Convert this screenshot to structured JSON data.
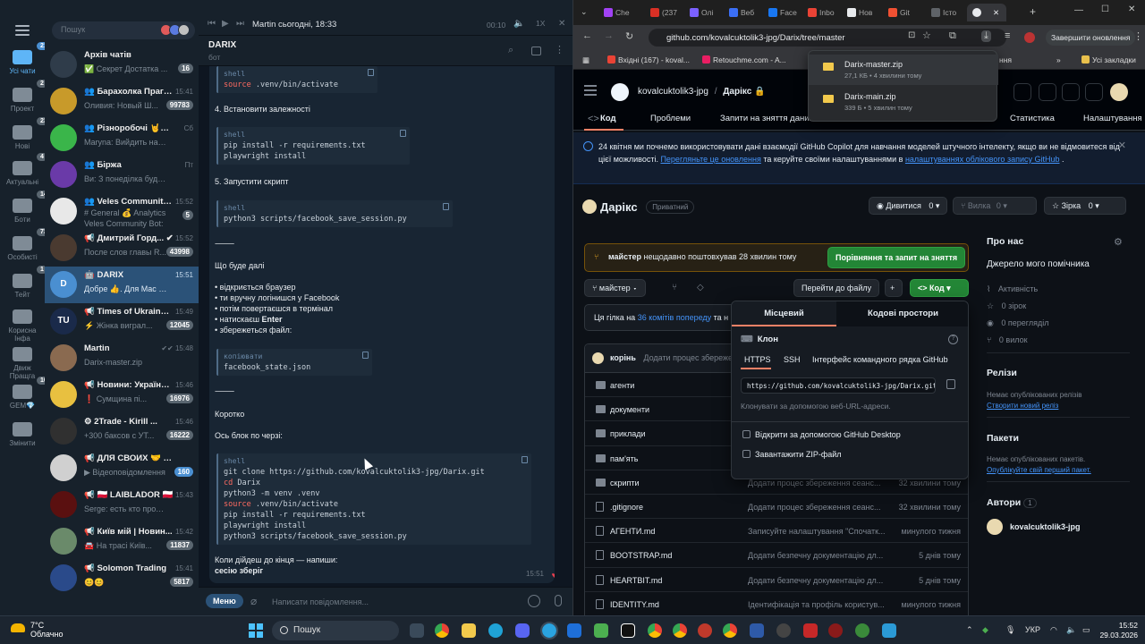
{
  "telegram": {
    "search_placeholder": "Пошук",
    "folders": [
      {
        "label": "Усі чати",
        "badge": "214",
        "active": true
      },
      {
        "label": "Проект",
        "badge": "2"
      },
      {
        "label": "Нові",
        "badge": "230"
      },
      {
        "label": "Актуальні",
        "badge": "4"
      },
      {
        "label": "Боти",
        "badge": "14"
      },
      {
        "label": "Особисті",
        "badge": "73"
      },
      {
        "label": "Тейт",
        "badge": "1"
      },
      {
        "label": "Корисна Інфа",
        "badge": ""
      },
      {
        "label": "Движ Пращга",
        "badge": ""
      },
      {
        "label": "GEM💎",
        "badge": "10"
      },
      {
        "label": "Змінити",
        "badge": ""
      }
    ],
    "chats": [
      {
        "name": "Архів чатів",
        "preview": "✅ Секрет Достатка ...",
        "time": "",
        "badge": "16",
        "color": "#2f3c4a"
      },
      {
        "name": "👥 Барахолка Прага...",
        "preview": "Оливия: Новый Ш...",
        "time": "15:41",
        "badge": "99783",
        "color": "#c89a2a"
      },
      {
        "name": "👥 Різноробочі 🤘😎...",
        "preview": "Maryna: Вийдить на двір",
        "time": "Сб",
        "badge": "",
        "color": "#3ab54a"
      },
      {
        "name": "👥 Біржа",
        "preview": "Ви: З понеділка буду то...",
        "time": "Пт",
        "badge": "",
        "color": "#6a3aa8"
      },
      {
        "name": "👥 Veles Community ...",
        "preview": "# General  💰 Analytics",
        "preview2": "Veles Community Bot:",
        "time": "15:52",
        "badge": "5",
        "color": "#e8e8e8"
      },
      {
        "name": "📢 Дмитрий Горд... ✔",
        "preview": "После слов главы R...",
        "time": "15:52",
        "badge": "43998",
        "color": "#4a3a30"
      },
      {
        "name": "🤖 DARIX",
        "preview": "Добре 👍. Для Mac команд...",
        "time": "15:51",
        "badge": "",
        "color": "#4a8fd1",
        "selected": true,
        "initial": "D"
      },
      {
        "name": "📢 Times of Ukraine:...",
        "preview": "⚡ Жінка виграл...",
        "time": "15:49",
        "badge": "12045",
        "color": "#1a2a4a",
        "initial": "TU"
      },
      {
        "name": "Martin",
        "preview": "Darix-master.zip",
        "time": "✔✔ 15:48",
        "badge": "",
        "color": "#8a6a50"
      },
      {
        "name": "📢 Новини: Україна ...",
        "preview": "❗ Сумщина пі...",
        "time": "15:46",
        "badge": "16976",
        "color": "#e8c040"
      },
      {
        "name": "⚙ 2Trade - Kirill ...",
        "preview": "+300 баксов с УТ...",
        "time": "15:46",
        "badge": "16222",
        "color": "#303030"
      },
      {
        "name": "📢 ДЛЯ СВОИХ 🤝 Д...",
        "preview": "▶ Відеоповідомлення",
        "time": "",
        "badge": "160",
        "color": "#d0d0d0",
        "blue": true
      },
      {
        "name": "📢 🇵🇱 LAIBLADOR 🇵🇱",
        "preview": "Serge: есть кто продает...",
        "time": "15:43",
        "badge": "",
        "color": "#5a1010"
      },
      {
        "name": "📢 Київ мій | Новин...",
        "preview": "🚘 На трасі Київ...",
        "time": "15:42",
        "badge": "11837",
        "color": "#6a8a6a"
      },
      {
        "name": "📢 Solomon Trading",
        "preview": "😊😊",
        "time": "15:41",
        "badge": "5817",
        "color": "#2a4a8a"
      }
    ],
    "media": {
      "title": "Martin сьогодні, 18:33",
      "time": "00:10",
      "speed": "1X"
    },
    "conversation": {
      "name": "DARIX",
      "subtitle": "бот"
    },
    "message": {
      "code0_lang": "shell",
      "code0_kw": "source",
      "code0_rest": " .venv/bin/activate",
      "step4": "4. Встановити залежності",
      "code1_lang": "shell",
      "code1_l1": "pip install -r requirements.txt",
      "code1_l2": "playwright install",
      "step5": "5. Запустити скрипт",
      "code2_lang": "shell",
      "code2_l1": "python3 scripts/facebook_save_session.py",
      "dash1": "⸻",
      "what": "Що буде далі",
      "b1": "• відкриється браузер",
      "b2": "• ти вручну логінишся у Facebook",
      "b3": "• потім повертаєшся в термінал",
      "b4a": "• натискаєш ",
      "b4b": "Enter",
      "b5": "• збережеться файл:",
      "code3_lang": "копіювати",
      "code3_l1": "facebook_state.json",
      "dash2": "⸻",
      "short": "Коротко",
      "block": "Ось блок по черзі:",
      "code4_lang": "shell",
      "code4_l1": "git clone https://github.com/kovalcuktolik3-jpg/Darix.git",
      "code4_kw_cd": "cd",
      "code4_l2": " Darix",
      "code4_l3": "python3 -m venv .venv",
      "code4_kw_src": "source",
      "code4_l4": " .venv/bin/activate",
      "code4_l5": "pip install -r requirements.txt",
      "code4_l6": "playwright install",
      "code4_l7": "python3 scripts/facebook_save_session.py",
      "end1": "Коли дійдеш до кінця — напиши:",
      "end2": "сесію зберіг",
      "time": "15:51"
    },
    "input": {
      "menu": "Меню",
      "placeholder": "Написати повідомлення..."
    }
  },
  "chrome": {
    "tabs": [
      "Che",
      "(237",
      "Олі",
      "Веб",
      "Face",
      "Inbo",
      "Нов",
      "Git",
      "Істо",
      ""
    ],
    "url": "github.com/kovalcuktolik3-jpg/Darix/tree/master",
    "end_session": "Завершити оновлення",
    "bookmarks": [
      "Вхідні (167) - koval...",
      "Retouchme.com - A..."
    ],
    "bookmarks_right": "Усі закладки",
    "bookmark_partial": "ння",
    "downloads": [
      {
        "name": "Darix-master.zip",
        "meta": "27,1 КБ • 4 хвилини тому"
      },
      {
        "name": "Darix-main.zip",
        "meta": "339 Б • 5 хвилин тому"
      }
    ]
  },
  "github": {
    "owner": "kovalcuktolik3-jpg",
    "repo": "Дарікс 🔒",
    "nav": [
      "Код",
      "Проблеми",
      "Запити на зняття даних",
      "Статистика",
      "Налаштування"
    ],
    "banner_text1": "24 квітня ми почнемо використовувати дані взаємодії GitHub Copilot для навчання моделей штучного інтелекту, якщо ви не відмовитеся від цієї можливості. ",
    "banner_link1": "Перегляньте це оновлення",
    "banner_text2": " та керуйте своїми налаштуваннями в ",
    "banner_link2": "налаштуваннях облікового запису GitHub",
    "banner_text3": " .",
    "title": "Дарікс",
    "visibility": "Приватний",
    "watch": "Дивитися",
    "watch_count": "0",
    "fork": "Вилка",
    "fork_count": "0",
    "star": "Зірка",
    "star_count": "0",
    "flash_branch": "майстер",
    "flash_text": " нещодавно поштовхував 28 хвилин тому",
    "compare_btn": "Порівняння та запит на зняття",
    "branch": "майстер",
    "goto_file": "Перейти до файлу",
    "code_btn": "Код",
    "branch_info_a": "Ця гілка на ",
    "branch_info_link": "36 комітів попереду",
    "branch_info_b": " та н",
    "commit_author": "корінь",
    "commit_msg": "Додати процес збереження...",
    "files": [
      {
        "name": "агенти",
        "msg": "",
        "time": "",
        "dir": true
      },
      {
        "name": "документи",
        "msg": "",
        "time": "",
        "dir": true
      },
      {
        "name": "приклади",
        "msg": "",
        "time": "",
        "dir": true
      },
      {
        "name": "пам'ять",
        "msg": "",
        "time": "",
        "dir": true
      },
      {
        "name": "скрипти",
        "msg": "Додати процес збереження сеанс...",
        "time": "32 хвилини тому",
        "dir": true
      },
      {
        "name": ".gitignore",
        "msg": "Додати процес збереження сеанс...",
        "time": "32 хвилини тому",
        "dir": false
      },
      {
        "name": "АГЕНТИ.md",
        "msg": "Записуйте налаштування \"Спочатк...",
        "time": "минулого тижня",
        "dir": false
      },
      {
        "name": "BOOTSTRAP.md",
        "msg": "Додати безпечну документацію дл...",
        "time": "5 днів тому",
        "dir": false
      },
      {
        "name": "HEARTBIT.md",
        "msg": "Додати безпечну документацію дл...",
        "time": "5 днів тому",
        "dir": false
      },
      {
        "name": "IDENTITY.md",
        "msg": "Ідентифікація та профіль користув...",
        "time": "минулого тижня",
        "dir": false
      }
    ],
    "clone": {
      "tab_local": "Місцевий",
      "tab_spaces": "Кодові простори",
      "title": "Клон",
      "protocols": [
        "HTTPS",
        "SSH",
        "Інтерфейс командного рядка GitHub"
      ],
      "url": "https://github.com/kovalcuktolik3-jpg/Darix.git",
      "hint": "Клонувати за допомогою веб-URL-адреси.",
      "open_desktop": "Відкрити за допомогою GitHub Desktop",
      "download_zip": "Завантажити ZIP-файл"
    },
    "about": {
      "title": "Про нас",
      "desc": "Джерело мого помічника",
      "activity": "Активність",
      "stars": "0 зірок",
      "watchers": "0 перегляділ",
      "forks": "0 вилок",
      "releases_title": "Релізи",
      "releases_empty": "Немає опублікованих релізів",
      "releases_link": "Створити новий реліз",
      "packages_title": "Пакети",
      "packages_empty": "Немає опублікованих пакетів.",
      "packages_link": "Опублікуйте свій перший пакет.",
      "authors_title": "Автори",
      "authors_count": "1",
      "author": "kovalcuktolik3-jpg"
    }
  },
  "taskbar": {
    "weather_temp": "7°C",
    "weather_desc": "Облачно",
    "search": "Пошук",
    "lang": "УКР",
    "time": "15:52",
    "date": "29.03.2026"
  }
}
